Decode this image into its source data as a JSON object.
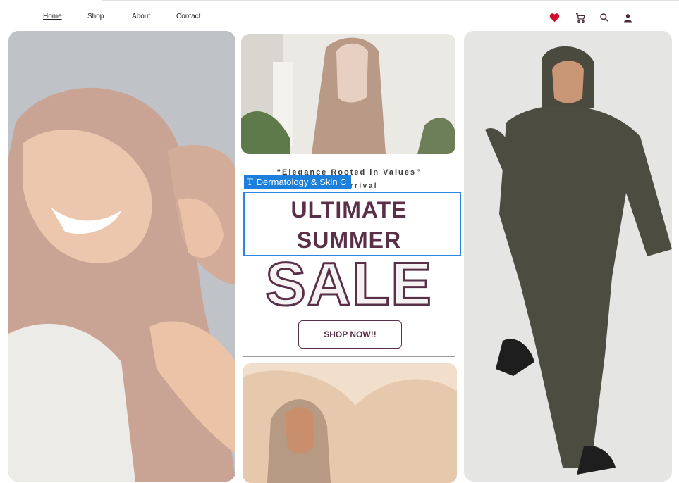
{
  "nav": {
    "home": "Home",
    "shop": "Shop",
    "about": "About",
    "contact": "Contact"
  },
  "header_icons": [
    "heart-icon",
    "cart-icon",
    "search-icon",
    "user-icon"
  ],
  "promo": {
    "tagline": "“Elegance Rooted in Values”",
    "new_arrival": "New Arrival",
    "headline_line1": "ULTIMATE",
    "headline_line2": "SUMMER",
    "sale": "SALE",
    "shop_button": "SHOP NOW!!"
  },
  "editor": {
    "selected_layer_label": "Dermatology & Skin C"
  },
  "colors": {
    "accent": "#5a2f48",
    "heart": "#d0102e",
    "selection": "#1d7fdc"
  }
}
